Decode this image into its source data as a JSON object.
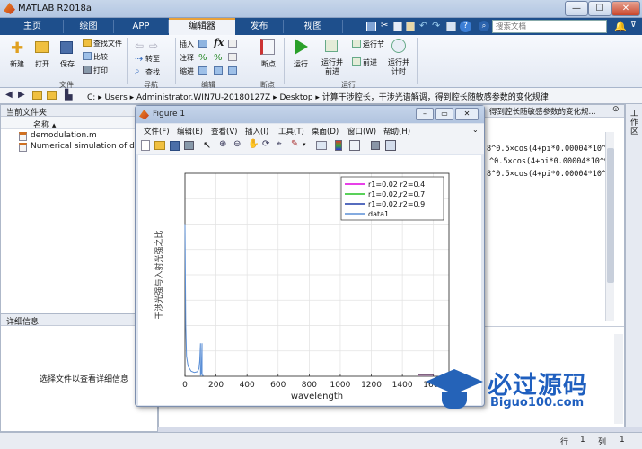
{
  "window": {
    "title": "MATLAB R2018a",
    "min": "—",
    "max": "☐",
    "close": "✕"
  },
  "tabs": [
    "主页",
    "绘图",
    "APP",
    "编辑器",
    "发布",
    "视图"
  ],
  "search": {
    "placeholder": "搜索文档"
  },
  "ribbon": {
    "file": {
      "new": "新建",
      "open": "打开",
      "save": "保存",
      "find_files": "查找文件",
      "compare": "比较",
      "print": "打印",
      "label": "文件"
    },
    "nav": {
      "goto": "转至",
      "find": "查找",
      "label": "导航"
    },
    "edit": {
      "insert": "插入",
      "comment": "注释",
      "indent": "缩进",
      "fx": "fx",
      "label": "编辑"
    },
    "breakpoints": {
      "bp": "断点",
      "label": "断点"
    },
    "run": {
      "run": "运行",
      "run_advance": "运行并\n前进",
      "run_section": "运行节",
      "advance": "前进",
      "run_time": "运行并\n计时",
      "label": "运行"
    }
  },
  "address": {
    "path": "C: ▸ Users ▸ Administrator.WIN7U-20180127Z ▸ Desktop ▸ 计算干涉腔长，干涉光谱解调，得到腔长随敏感参数的变化规律"
  },
  "current_folder": {
    "title": "当前文件夹",
    "col_name": "名称 ▴",
    "files": [
      "demodulation.m",
      "Numerical simulation of drop"
    ]
  },
  "details": {
    "title": "详细信息",
    "hint": "选择文件以查看详细信息"
  },
  "editor_tab": "得到腔长随敏感参数的变化规...",
  "code_lines": [
    "8^0.5×cos(4+pi*0.00004*10^9.",
    "^0.5×cos(4+pi*0.00004*10^9.",
    "8^0.5×cos(4+pi*0.00004*10^9."
  ],
  "right_label": "工作区",
  "status": {
    "row_label": "行",
    "row": "1",
    "col_label": "列",
    "col": "1"
  },
  "figure": {
    "title": "Figure 1",
    "menu": [
      "文件(F)",
      "编辑(E)",
      "查看(V)",
      "插入(I)",
      "工具(T)",
      "桌面(D)",
      "窗口(W)",
      "帮助(H)"
    ]
  },
  "watermark": {
    "main": "必过源码",
    "sub": "Biguo100.com"
  },
  "chart_data": {
    "type": "line",
    "xlabel": "wavelength",
    "ylabel": "干涉光强与入射光强之比",
    "xlim": [
      0,
      1700
    ],
    "ylim": [
      0,
      80
    ],
    "xticks": [
      0,
      200,
      400,
      600,
      800,
      1000,
      1200,
      1400,
      1600
    ],
    "grid": true,
    "legend_position": "top-right",
    "series": [
      {
        "name": "r1=0.02 r2=0.4",
        "color": "#e000e0",
        "x": [
          1500,
          1600
        ],
        "y": [
          0.5,
          0.5
        ]
      },
      {
        "name": "r1=0.02,r2=0.7",
        "color": "#22c322",
        "x": [
          1500,
          1600
        ],
        "y": [
          0.7,
          0.7
        ]
      },
      {
        "name": "r1=0.02,r2=0.9",
        "color": "#1f3ba8",
        "x": [
          1500,
          1600
        ],
        "y": [
          0.9,
          0.9
        ]
      },
      {
        "name": "data1",
        "color": "#5b8fd6",
        "x": [
          0,
          5,
          10,
          20,
          40,
          60,
          80,
          90,
          95,
          100,
          100,
          105,
          110,
          110,
          115,
          120
        ],
        "y": [
          60,
          20,
          8,
          4,
          2,
          1.5,
          1.8,
          3,
          6,
          13,
          0.5,
          1,
          13,
          0.5,
          0.3,
          0.3
        ]
      }
    ]
  }
}
